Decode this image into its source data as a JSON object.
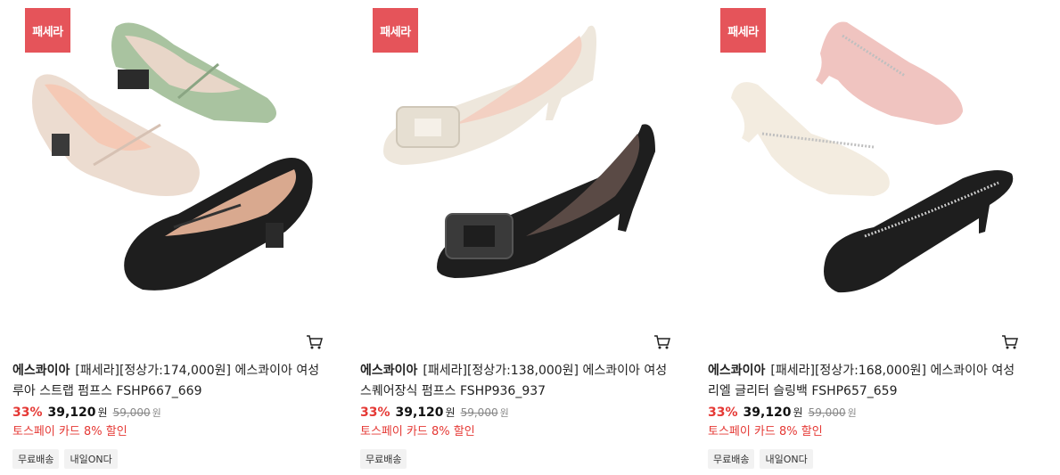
{
  "products": [
    {
      "badge": "패세라",
      "brand": "에스콰이아",
      "title": "[패세라][정상가:174,000원] 에스콰이아 여성 루아 스트랩 펌프스 FSHP667_669",
      "discount": "33%",
      "price": "39,120",
      "price_unit": "원",
      "original_price": "59,000",
      "original_unit": "원",
      "promo": "토스페이 카드 8% 할인",
      "tags": [
        "무료배송",
        "내일ON다"
      ],
      "image": "mary-jane-pumps"
    },
    {
      "badge": "패세라",
      "brand": "에스콰이아",
      "title": "[패세라][정상가:138,000원] 에스콰이아 여성 스퀘어장식 펌프스 FSHP936_937",
      "discount": "33%",
      "price": "39,120",
      "price_unit": "원",
      "original_price": "59,000",
      "original_unit": "원",
      "promo": "토스페이 카드 8% 할인",
      "tags": [
        "무료배송"
      ],
      "image": "square-buckle-pumps"
    },
    {
      "badge": "패세라",
      "brand": "에스콰이아",
      "title": "[패세라][정상가:168,000원] 에스콰이아 여성 리엘 글리터 슬링백 FSHP657_659",
      "discount": "33%",
      "price": "39,120",
      "price_unit": "원",
      "original_price": "59,000",
      "original_unit": "원",
      "promo": "토스페이 카드 8% 할인",
      "tags": [
        "무료배송",
        "내일ON다"
      ],
      "image": "glitter-slingback"
    }
  ],
  "colors": {
    "badge": "#e5545a",
    "discount": "#e53935",
    "promo": "#e53935"
  }
}
